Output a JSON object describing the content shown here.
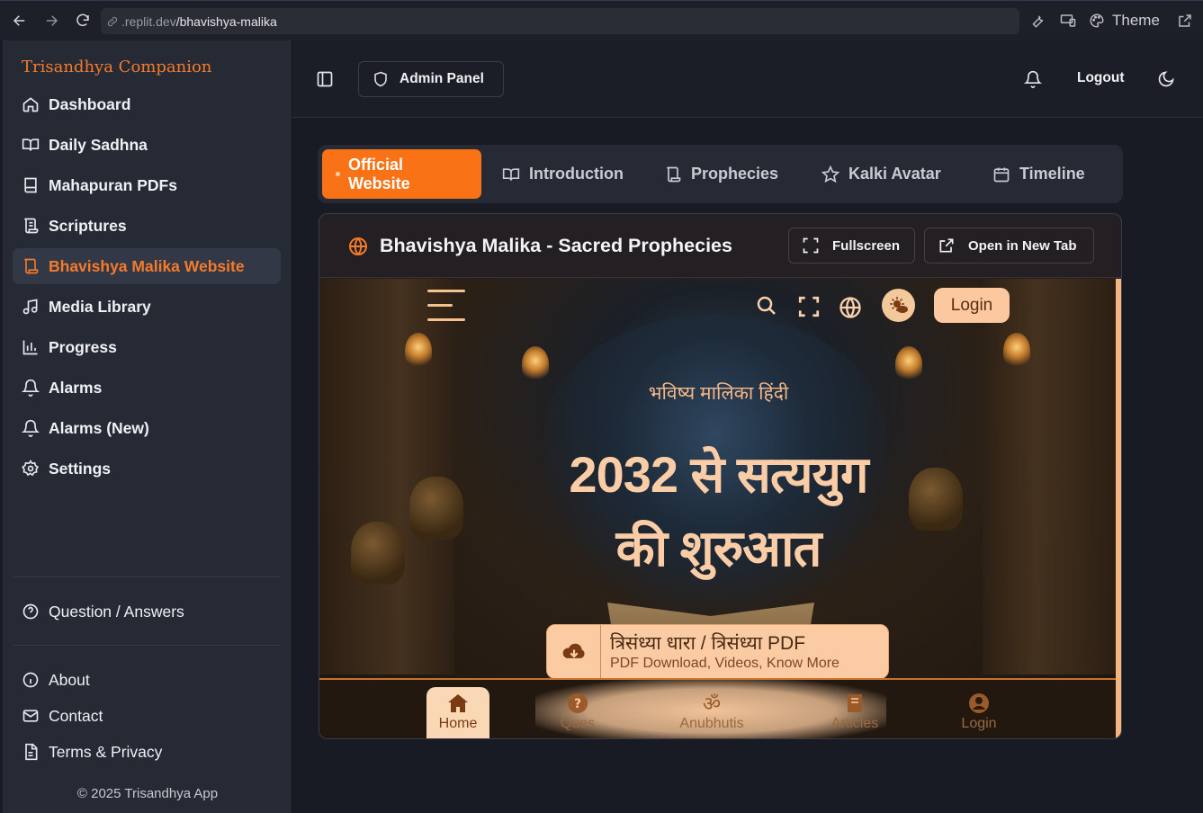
{
  "browser": {
    "url_host": ".replit.dev",
    "url_path": "/bhavishya-malika",
    "theme_label": "Theme"
  },
  "sidebar": {
    "brand": "Trisandhya Companion",
    "items": [
      {
        "label": "Dashboard",
        "icon": "home-icon"
      },
      {
        "label": "Daily Sadhna",
        "icon": "book-open-icon"
      },
      {
        "label": "Mahapuran PDFs",
        "icon": "book-icon"
      },
      {
        "label": "Scriptures",
        "icon": "scroll-icon"
      },
      {
        "label": "Bhavishya Malika Website",
        "icon": "scroll-icon",
        "active": true
      },
      {
        "label": "Media Library",
        "icon": "music-icon"
      },
      {
        "label": "Progress",
        "icon": "bar-chart-icon"
      },
      {
        "label": "Alarms",
        "icon": "bell-icon"
      },
      {
        "label": "Alarms (New)",
        "icon": "bell-icon"
      },
      {
        "label": "Settings",
        "icon": "gear-icon"
      }
    ],
    "qa": "Question / Answers",
    "footer_items": [
      {
        "label": "About",
        "icon": "info-icon"
      },
      {
        "label": "Contact",
        "icon": "mail-icon"
      },
      {
        "label": "Terms & Privacy",
        "icon": "document-icon"
      }
    ],
    "copyright": "© 2025 Trisandhya App"
  },
  "header": {
    "admin_panel": "Admin Panel",
    "logout": "Logout"
  },
  "tabs": [
    {
      "label": "Official Website",
      "active": true
    },
    {
      "label": "Introduction",
      "icon": "book-open-icon"
    },
    {
      "label": "Prophecies",
      "icon": "scroll-icon"
    },
    {
      "label": "Kalki Avatar",
      "icon": "star-icon"
    },
    {
      "label": "Timeline",
      "icon": "calendar-icon"
    }
  ],
  "panel": {
    "title": "Bhavishya Malika - Sacred Prophecies",
    "fullscreen": "Fullscreen",
    "open_new_tab": "Open in New Tab"
  },
  "site": {
    "login_top": "Login",
    "subtitle": "भविष्य मालिका हिंदी",
    "headline_line1": "2032 से सत्ययुग",
    "headline_line2": "की शुरुआत",
    "cta_title": "त्रिसंध्या धारा / त्रिसंध्या PDF",
    "cta_sub": "PDF Download, Videos, Know More",
    "bottom_nav": [
      {
        "label": "Home",
        "icon": "home-icon",
        "active": true
      },
      {
        "label": "Ques",
        "icon": "question-icon"
      },
      {
        "label": "Anubhutis",
        "icon": "om-icon"
      },
      {
        "label": "Articles",
        "icon": "book-icon"
      },
      {
        "label": "Login",
        "icon": "user-icon"
      }
    ]
  },
  "colors": {
    "accent": "#f97316",
    "brand": "#f47a2c",
    "site_peach": "#fbcba3"
  }
}
